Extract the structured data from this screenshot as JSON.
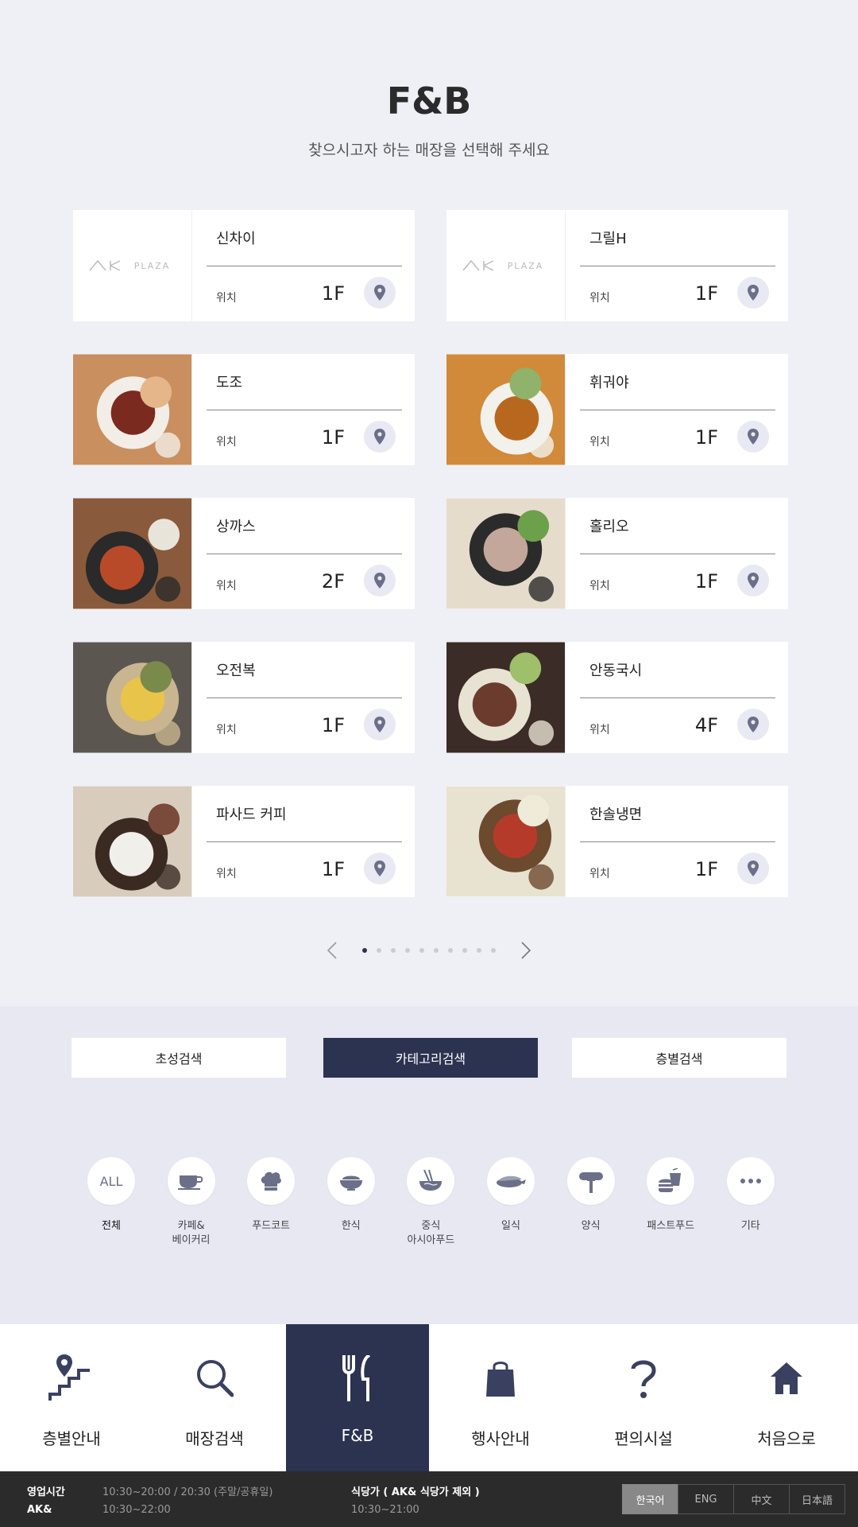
{
  "header": {
    "title": "F&B",
    "subtitle": "찾으시고자 하는 매장을 선택해 주세요"
  },
  "stores": [
    {
      "name": "신차이",
      "location_label": "위치",
      "floor": "1F",
      "thumb": "logo"
    },
    {
      "name": "그릴H",
      "location_label": "위치",
      "floor": "1F",
      "thumb": "logo"
    },
    {
      "name": "도조",
      "location_label": "위치",
      "floor": "1F",
      "thumb": "photo"
    },
    {
      "name": "휘궈야",
      "location_label": "위치",
      "floor": "1F",
      "thumb": "photo"
    },
    {
      "name": "상까스",
      "location_label": "위치",
      "floor": "2F",
      "thumb": "photo"
    },
    {
      "name": "홀리오",
      "location_label": "위치",
      "floor": "1F",
      "thumb": "photo"
    },
    {
      "name": "오전복",
      "location_label": "위치",
      "floor": "1F",
      "thumb": "photo"
    },
    {
      "name": "안동국시",
      "location_label": "위치",
      "floor": "4F",
      "thumb": "photo"
    },
    {
      "name": "파사드 커피",
      "location_label": "위치",
      "floor": "1F",
      "thumb": "photo"
    },
    {
      "name": "한솔냉면",
      "location_label": "위치",
      "floor": "1F",
      "thumb": "photo"
    }
  ],
  "logo_text": "AK PLAZA",
  "pagination": {
    "current": 1,
    "total": 10
  },
  "search_tabs": [
    {
      "label": "초성검색",
      "active": false
    },
    {
      "label": "카테고리검색",
      "active": true
    },
    {
      "label": "층별검색",
      "active": false
    }
  ],
  "categories": [
    {
      "label": "전체",
      "icon": "all-icon",
      "icon_text": "ALL",
      "active": true
    },
    {
      "label": "카페&\n베이커리",
      "icon": "coffee-cup-icon"
    },
    {
      "label": "푸드코트",
      "icon": "chef-hat-icon"
    },
    {
      "label": "한식",
      "icon": "rice-bowl-icon"
    },
    {
      "label": "중식\n아시아푸드",
      "icon": "noodle-bowl-icon"
    },
    {
      "label": "일식",
      "icon": "sushi-icon"
    },
    {
      "label": "양식",
      "icon": "sausage-fork-icon"
    },
    {
      "label": "패스트푸드",
      "icon": "burger-drink-icon"
    },
    {
      "label": "기타",
      "icon": "more-icon"
    }
  ],
  "nav": [
    {
      "label": "층별안내",
      "icon": "floor-stairs-icon",
      "active": false
    },
    {
      "label": "매장검색",
      "icon": "search-icon",
      "active": false
    },
    {
      "label": "F&B",
      "icon": "fork-knife-icon",
      "active": true
    },
    {
      "label": "행사안내",
      "icon": "shopping-bag-icon",
      "active": false
    },
    {
      "label": "편의시설",
      "icon": "question-icon",
      "active": false
    },
    {
      "label": "처음으로",
      "icon": "home-icon",
      "active": false
    }
  ],
  "footer": {
    "hours_label": "영업시간",
    "hours_value": "10:30~20:00 / 20:30 (주말/공휴일)",
    "ak_label": "AK&",
    "ak_value": "10:30~22:00",
    "dining_label": "식당가 ( AK& 식당가 제외 )",
    "dining_value": "10:30~21:00"
  },
  "languages": [
    {
      "label": "한국어",
      "active": true
    },
    {
      "label": "ENG",
      "active": false
    },
    {
      "label": "中文",
      "active": false
    },
    {
      "label": "日本語",
      "active": false
    }
  ],
  "colors": {
    "accent": "#2c3350",
    "background": "#eff0f6",
    "icon": "#6b6f88"
  }
}
